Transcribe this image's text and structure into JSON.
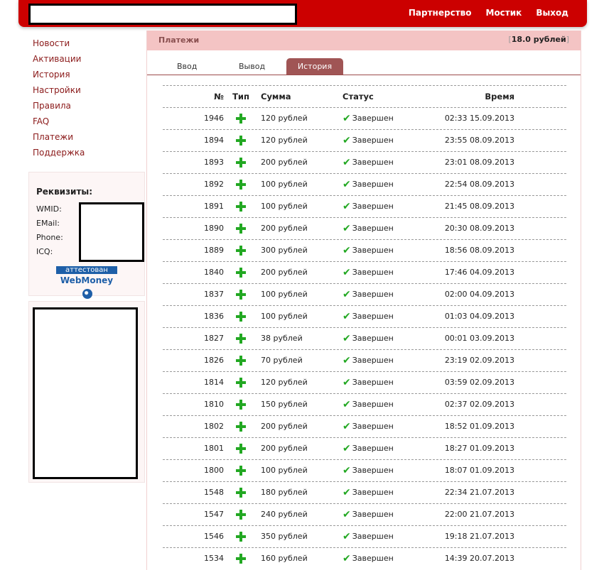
{
  "topnav": {
    "items": [
      "Партнерство",
      "Мостик",
      "Выход"
    ]
  },
  "sidebar": {
    "items": [
      "Новости",
      "Активации",
      "История",
      "Настройки",
      "Правила",
      "FAQ",
      "Платежи",
      "Поддержка"
    ]
  },
  "requisites": {
    "title": "Реквизиты:",
    "labels": [
      "WMID:",
      "EMail:",
      "Phone:",
      "ICQ:"
    ],
    "badge_top": "аттестован",
    "badge_bottom": "WebMoney"
  },
  "panel": {
    "title": "Платежи",
    "balance": "18.0 рублей"
  },
  "tabs": [
    {
      "label": "Ввод",
      "active": false
    },
    {
      "label": "Вывод",
      "active": false
    },
    {
      "label": "История",
      "active": true
    }
  ],
  "table": {
    "headers": {
      "num": "№",
      "type": "Тип",
      "sum": "Сумма",
      "status": "Статус",
      "time": "Время"
    },
    "rows": [
      {
        "num": "1946",
        "sum": "120 рублей",
        "status": "Завершен",
        "time": "02:33 15.09.2013"
      },
      {
        "num": "1894",
        "sum": "120 рублей",
        "status": "Завершен",
        "time": "23:55 08.09.2013"
      },
      {
        "num": "1893",
        "sum": "200 рублей",
        "status": "Завершен",
        "time": "23:01 08.09.2013"
      },
      {
        "num": "1892",
        "sum": "100 рублей",
        "status": "Завершен",
        "time": "22:54 08.09.2013"
      },
      {
        "num": "1891",
        "sum": "100 рублей",
        "status": "Завершен",
        "time": "21:45 08.09.2013"
      },
      {
        "num": "1890",
        "sum": "200 рублей",
        "status": "Завершен",
        "time": "20:30 08.09.2013"
      },
      {
        "num": "1889",
        "sum": "300 рублей",
        "status": "Завершен",
        "time": "18:56 08.09.2013"
      },
      {
        "num": "1840",
        "sum": "200 рублей",
        "status": "Завершен",
        "time": "17:46 04.09.2013"
      },
      {
        "num": "1837",
        "sum": "100 рублей",
        "status": "Завершен",
        "time": "02:00 04.09.2013"
      },
      {
        "num": "1836",
        "sum": "100 рублей",
        "status": "Завершен",
        "time": "01:03 04.09.2013"
      },
      {
        "num": "1827",
        "sum": "38 рублей",
        "status": "Завершен",
        "time": "00:01 03.09.2013"
      },
      {
        "num": "1826",
        "sum": "70 рублей",
        "status": "Завершен",
        "time": "23:19 02.09.2013"
      },
      {
        "num": "1814",
        "sum": "120 рублей",
        "status": "Завершен",
        "time": "03:59 02.09.2013"
      },
      {
        "num": "1810",
        "sum": "150 рублей",
        "status": "Завершен",
        "time": "02:37 02.09.2013"
      },
      {
        "num": "1802",
        "sum": "200 рублей",
        "status": "Завершен",
        "time": "18:52 01.09.2013"
      },
      {
        "num": "1801",
        "sum": "200 рублей",
        "status": "Завершен",
        "time": "18:27 01.09.2013"
      },
      {
        "num": "1800",
        "sum": "100 рублей",
        "status": "Завершен",
        "time": "18:07 01.09.2013"
      },
      {
        "num": "1548",
        "sum": "180 рублей",
        "status": "Завершен",
        "time": "22:34 21.07.2013"
      },
      {
        "num": "1547",
        "sum": "240 рублей",
        "status": "Завершен",
        "time": "22:00 21.07.2013"
      },
      {
        "num": "1546",
        "sum": "350 рублей",
        "status": "Завершен",
        "time": "19:18 21.07.2013"
      },
      {
        "num": "1534",
        "sum": "160 рублей",
        "status": "Завершен",
        "time": "14:39 20.07.2013"
      }
    ]
  },
  "colors": {
    "header_red": "#cc0000",
    "link": "#8b1a1a",
    "panel_header": "#f4c4c4",
    "active_tab": "#a05555",
    "plus_green": "#22a822"
  }
}
